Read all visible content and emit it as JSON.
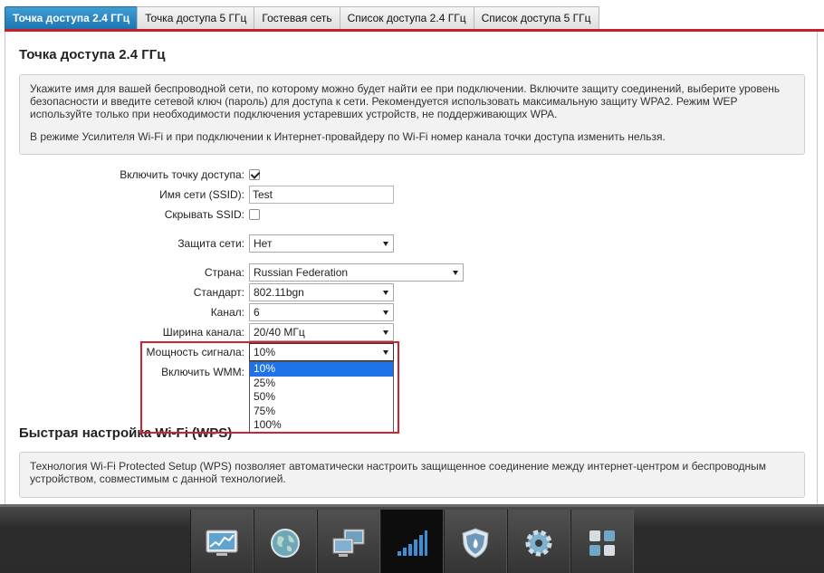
{
  "tabs": [
    {
      "label": "Точка доступа 2.4 ГГц",
      "active": true
    },
    {
      "label": "Точка доступа 5 ГГц",
      "active": false
    },
    {
      "label": "Гостевая сеть",
      "active": false
    },
    {
      "label": "Список доступа 2.4 ГГц",
      "active": false
    },
    {
      "label": "Список доступа 5 ГГц",
      "active": false
    }
  ],
  "ap_section": {
    "title": "Точка доступа 2.4 ГГц",
    "info_p1": "Укажите имя для вашей беспроводной сети, по которому можно будет найти ее при подключении. Включите защиту соединений, выберите уровень безопасности и введите сетевой ключ (пароль) для доступа к сети. Рекомендуется использовать максимальную защиту WPA2. Режим WEP используйте только при необходимости подключения устаревших устройств, не поддерживающих WPA.",
    "info_p2": "В режиме Усилителя Wi-Fi и при подключении к Интернет-провайдеру по Wi-Fi номер канала точки доступа изменить нельзя."
  },
  "form": {
    "enable_ap_label": "Включить точку доступа:",
    "enable_ap_checked": true,
    "ssid_label": "Имя сети (SSID):",
    "ssid_value": "Test",
    "hide_ssid_label": "Скрывать SSID:",
    "hide_ssid_checked": false,
    "security_label": "Защита сети:",
    "security_value": "Нет",
    "country_label": "Страна:",
    "country_value": "Russian Federation",
    "standard_label": "Стандарт:",
    "standard_value": "802.11bgn",
    "channel_label": "Канал:",
    "channel_value": "6",
    "width_label": "Ширина канала:",
    "width_value": "20/40 МГц",
    "power_label": "Мощность сигнала:",
    "power_value": "10%",
    "power_options": [
      "10%",
      "25%",
      "50%",
      "75%",
      "100%"
    ],
    "wmm_label": "Включить WMM:"
  },
  "wps_section": {
    "title": "Быстрая настройка Wi-Fi (WPS)",
    "info": "Технология Wi-Fi Protected Setup (WPS) позволяет автоматически настроить защищенное соединение между интернет-центром и беспроводным устройством, совместимым с данной технологией."
  },
  "toolbar": {
    "icons": [
      "monitor-chart-icon",
      "globe-icon",
      "network-computers-icon",
      "wifi-signal-icon",
      "firewall-shield-icon",
      "gear-icon",
      "apps-grid-icon"
    ],
    "active_index": 3
  },
  "colors": {
    "tab_active": "#1b74b1",
    "accent_red": "#c8212b",
    "selection_blue": "#1e73e8",
    "toolbar_bg": "#2d2d2d"
  }
}
